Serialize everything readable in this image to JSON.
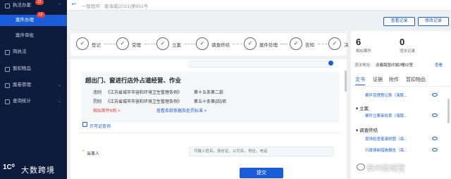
{
  "sidebar": {
    "items": [
      {
        "label": "执法办案",
        "badge": "12"
      },
      {
        "label": "案件办理",
        "badge": "12"
      },
      {
        "label": "案件审批"
      },
      {
        "label": "简执法"
      },
      {
        "label": "暂扣物品"
      },
      {
        "label": "案卷管理"
      },
      {
        "label": "查询统计"
      }
    ],
    "logo_text": "大数跨境"
  },
  "header": {
    "back_label": "一般程序",
    "case_number": "泰海城(2021)第651号"
  },
  "steps": [
    {
      "label": "登记"
    },
    {
      "label": "受理"
    },
    {
      "label": "立案"
    },
    {
      "label": "调查终结"
    },
    {
      "label": "案件处理"
    },
    {
      "label": "告知"
    },
    {
      "label": "决"
    }
  ],
  "case": {
    "title": "超出门、窗进行店外占道经营、作业",
    "violation_label": "违则",
    "violation_law": "《江苏省城市市容和环境卫生管理条例》",
    "violation_article": "第十五条第二款",
    "penalty_label": "罚则",
    "penalty_law": "《江苏省城市市容和环境卫生管理条例》",
    "penalty_article": "第五十条第(四)项",
    "similar_cases": "相似案件6例 >",
    "view_basis": "查看条款依据及处罚标准 >",
    "permit_query": "许可证查询",
    "party_label": "当事人",
    "party_placeholder": "可输入姓名，身份证，公司名，地址，电话"
  },
  "submit_label": "提交",
  "right": {
    "buttons": [
      "查看记录",
      "修改记录"
    ],
    "stats": [
      {
        "value": "6",
        "label": "相似案件"
      },
      {
        "value": "0",
        "label": "违法记录"
      }
    ],
    "address_label": "违法地址:",
    "address_value": "迎春路暨欣城2幢02室",
    "address_link": "查看",
    "tabs": [
      "文书",
      "证据",
      "附件",
      "暂扣物品"
    ],
    "docs": [
      {
        "group": "",
        "items": [
          "案件受理登记表（海陵..."
        ]
      },
      {
        "group": "立案",
        "items": [
          "案件立案审批表（海陵..."
        ]
      },
      {
        "group": "调查终结",
        "items": [
          "现场检查笔录附图（海...",
          "行政强制措施报告（海..."
        ]
      }
    ]
  },
  "watermark": "泰州微城管"
}
